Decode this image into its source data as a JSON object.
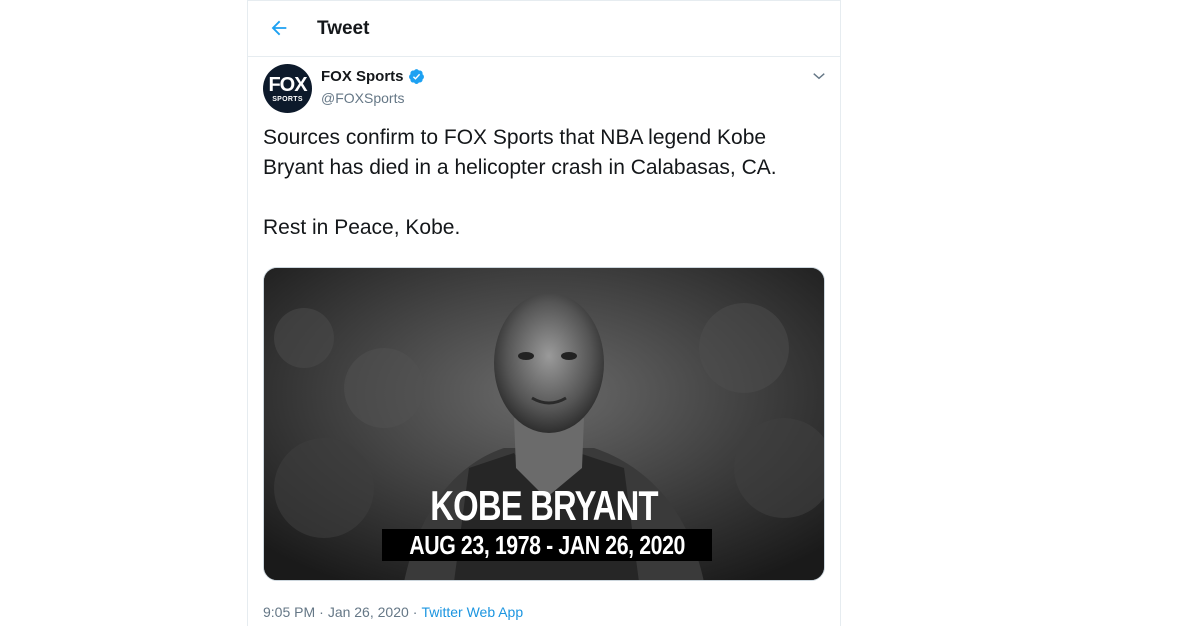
{
  "header": {
    "title": "Tweet",
    "back_icon": "arrow-left-icon"
  },
  "tweet": {
    "author": {
      "display_name": "FOX Sports",
      "handle": "@FOXSports",
      "verified": true,
      "avatar_text_top": "FOX",
      "avatar_text_bottom": "SPORTS"
    },
    "text_lines": [
      "Sources confirm to FOX Sports that NBA legend Kobe Bryant has died in a helicopter crash in Calabasas, CA.",
      "Rest in Peace, Kobe."
    ],
    "media": {
      "caption_name": "KOBE BRYANT",
      "caption_dates": "AUG 23, 1978 - JAN 26, 2020"
    },
    "meta": {
      "time": "9:05 PM",
      "separator": "·",
      "date": "Jan 26, 2020",
      "separator2": "·",
      "source": "Twitter Web App"
    }
  },
  "colors": {
    "accent": "#1da1f2",
    "link": "#1b95e0",
    "secondary_text": "#657786",
    "border": "#e6ecf0"
  }
}
